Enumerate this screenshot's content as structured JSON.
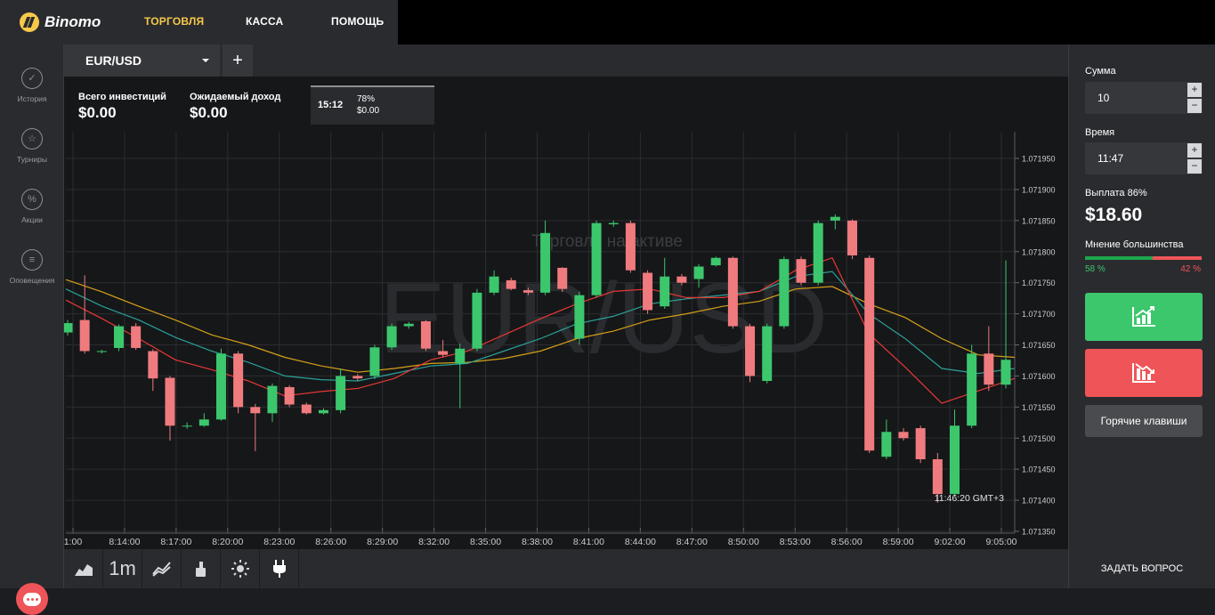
{
  "header": {
    "brand": "Binomo",
    "nav": [
      "ТОРГОВЛЯ",
      "КАССА",
      "ПОМОЩЬ"
    ]
  },
  "sidebar": {
    "items": [
      {
        "label": "История",
        "icon": "check-circle-icon"
      },
      {
        "label": "Турниры",
        "icon": "trophy-star-icon"
      },
      {
        "label": "Акции",
        "icon": "percent-circle-icon"
      },
      {
        "label": "Оповещения",
        "icon": "menu-lines-icon"
      }
    ]
  },
  "tab": {
    "symbol": "EUR/USD",
    "add_label": "+"
  },
  "stats": {
    "total_label": "Всего инвестиций",
    "total_value": "$0.00",
    "expected_label": "Ожидаемый доход",
    "expected_value": "$0.00"
  },
  "deal": {
    "time": "15:12",
    "percent": "78%",
    "amount": "$0.00"
  },
  "chart_data": {
    "type": "candlestick",
    "watermark": "EUR/USD",
    "overlay_text": "Торговля на активе",
    "time_label": "11:46:20 GMT+3",
    "y_ticks": [
      "1.071950",
      "1.071900",
      "1.071850",
      "1.071800",
      "1.071750",
      "1.071700",
      "1.071650",
      "1.071600",
      "1.071550",
      "1.071500",
      "1.071450",
      "1.071400",
      "1.071350"
    ],
    "ylim": [
      1.07135,
      1.07195
    ],
    "x_ticks": [
      "1:00",
      "8:14:00",
      "8:17:00",
      "8:20:00",
      "8:23:00",
      "8:26:00",
      "8:29:00",
      "8:32:00",
      "8:35:00",
      "8:38:00",
      "8:41:00",
      "8:44:00",
      "8:47:00",
      "8:50:00",
      "8:53:00",
      "8:56:00",
      "8:59:00",
      "9:02:00",
      "9:05:00"
    ],
    "up_color": "#3cc76d",
    "down_color": "#ef7b7e",
    "candles": [
      {
        "o": 1.07167,
        "c": 1.071685,
        "h": 1.07169,
        "l": 1.071665
      },
      {
        "o": 1.07169,
        "c": 1.07164,
        "h": 1.071762,
        "l": 1.071636
      },
      {
        "o": 1.07164,
        "c": 1.07164,
        "h": 1.071642,
        "l": 1.071636
      },
      {
        "o": 1.071645,
        "c": 1.07168,
        "h": 1.071683,
        "l": 1.07164
      },
      {
        "o": 1.07168,
        "c": 1.071645,
        "h": 1.071685,
        "l": 1.071642
      },
      {
        "o": 1.07164,
        "c": 1.071596,
        "h": 1.071643,
        "l": 1.071576
      },
      {
        "o": 1.071597,
        "c": 1.07152,
        "h": 1.0716,
        "l": 1.071496
      },
      {
        "o": 1.07152,
        "c": 1.07152,
        "h": 1.071525,
        "l": 1.071515
      },
      {
        "o": 1.07152,
        "c": 1.07153,
        "h": 1.07154,
        "l": 1.071518
      },
      {
        "o": 1.07153,
        "c": 1.071636,
        "h": 1.071644,
        "l": 1.071528
      },
      {
        "o": 1.071636,
        "c": 1.07155,
        "h": 1.07164,
        "l": 1.07154
      },
      {
        "o": 1.07155,
        "c": 1.07154,
        "h": 1.071555,
        "l": 1.071479
      },
      {
        "o": 1.07154,
        "c": 1.071584,
        "h": 1.071588,
        "l": 1.071526
      },
      {
        "o": 1.071582,
        "c": 1.071554,
        "h": 1.071585,
        "l": 1.07155
      },
      {
        "o": 1.071554,
        "c": 1.07154,
        "h": 1.071557,
        "l": 1.071538
      },
      {
        "o": 1.07154,
        "c": 1.071545,
        "h": 1.071548,
        "l": 1.071538
      },
      {
        "o": 1.071545,
        "c": 1.0716,
        "h": 1.071612,
        "l": 1.07154
      },
      {
        "o": 1.0716,
        "c": 1.071596,
        "h": 1.071603,
        "l": 1.071592
      },
      {
        "o": 1.0716,
        "c": 1.071646,
        "h": 1.07165,
        "l": 1.071595
      },
      {
        "o": 1.071646,
        "c": 1.07168,
        "h": 1.071684,
        "l": 1.071642
      },
      {
        "o": 1.07168,
        "c": 1.071684,
        "h": 1.071687,
        "l": 1.071676
      },
      {
        "o": 1.071688,
        "c": 1.071644,
        "h": 1.07169,
        "l": 1.07164
      },
      {
        "o": 1.07164,
        "c": 1.071634,
        "h": 1.071658,
        "l": 1.07163
      },
      {
        "o": 1.07162,
        "c": 1.071644,
        "h": 1.071652,
        "l": 1.071548
      },
      {
        "o": 1.071644,
        "c": 1.071734,
        "h": 1.07174,
        "l": 1.07164
      },
      {
        "o": 1.071734,
        "c": 1.07176,
        "h": 1.07177,
        "l": 1.07173
      },
      {
        "o": 1.071754,
        "c": 1.07174,
        "h": 1.071758,
        "l": 1.071738
      },
      {
        "o": 1.071738,
        "c": 1.071734,
        "h": 1.071742,
        "l": 1.07173
      },
      {
        "o": 1.071734,
        "c": 1.07183,
        "h": 1.07185,
        "l": 1.07173
      },
      {
        "o": 1.071774,
        "c": 1.07174,
        "h": 1.071775,
        "l": 1.071735
      },
      {
        "o": 1.07166,
        "c": 1.07173,
        "h": 1.071736,
        "l": 1.07165
      },
      {
        "o": 1.07173,
        "c": 1.071846,
        "h": 1.07185,
        "l": 1.071726
      },
      {
        "o": 1.071844,
        "c": 1.071846,
        "h": 1.07185,
        "l": 1.07184
      },
      {
        "o": 1.071846,
        "c": 1.07177,
        "h": 1.07185,
        "l": 1.071766
      },
      {
        "o": 1.071766,
        "c": 1.071706,
        "h": 1.07177,
        "l": 1.0717
      },
      {
        "o": 1.071712,
        "c": 1.07176,
        "h": 1.07179,
        "l": 1.071708
      },
      {
        "o": 1.07176,
        "c": 1.07175,
        "h": 1.071764,
        "l": 1.071746
      },
      {
        "o": 1.071756,
        "c": 1.071776,
        "h": 1.07178,
        "l": 1.071742
      },
      {
        "o": 1.071778,
        "c": 1.07179,
        "h": 1.071792,
        "l": 1.071776
      },
      {
        "o": 1.07179,
        "c": 1.07168,
        "h": 1.071792,
        "l": 1.071676
      },
      {
        "o": 1.07168,
        "c": 1.0716,
        "h": 1.071684,
        "l": 1.07159
      },
      {
        "o": 1.071592,
        "c": 1.07168,
        "h": 1.071684,
        "l": 1.071588
      },
      {
        "o": 1.07168,
        "c": 1.071788,
        "h": 1.071792,
        "l": 1.071676
      },
      {
        "o": 1.071788,
        "c": 1.07175,
        "h": 1.071792,
        "l": 1.071746
      },
      {
        "o": 1.07175,
        "c": 1.071846,
        "h": 1.07185,
        "l": 1.071746
      },
      {
        "o": 1.07185,
        "c": 1.071856,
        "h": 1.07186,
        "l": 1.071836
      },
      {
        "o": 1.07185,
        "c": 1.071794,
        "h": 1.071852,
        "l": 1.071788
      },
      {
        "o": 1.07179,
        "c": 1.07148,
        "h": 1.071794,
        "l": 1.071476
      },
      {
        "o": 1.07147,
        "c": 1.07151,
        "h": 1.07153,
        "l": 1.071466
      },
      {
        "o": 1.07151,
        "c": 1.0715,
        "h": 1.071516,
        "l": 1.071496
      },
      {
        "o": 1.071516,
        "c": 1.071466,
        "h": 1.07152,
        "l": 1.07146
      },
      {
        "o": 1.071466,
        "c": 1.07141,
        "h": 1.071476,
        "l": 1.071396
      },
      {
        "o": 1.07141,
        "c": 1.07152,
        "h": 1.071546,
        "l": 1.071406
      },
      {
        "o": 1.07152,
        "c": 1.071636,
        "h": 1.07165,
        "l": 1.071516
      },
      {
        "o": 1.071636,
        "c": 1.071586,
        "h": 1.07168,
        "l": 1.071576
      },
      {
        "o": 1.071586,
        "c": 1.071626,
        "h": 1.071786,
        "l": 1.07158
      }
    ],
    "ma_lines": [
      {
        "color": "#d4a017",
        "values": [
          1.071755,
          1.071735,
          1.071712,
          1.07169,
          1.071666,
          1.07165,
          1.07163,
          1.071616,
          1.071606,
          1.071612,
          1.07162,
          1.071622,
          1.071628,
          1.07164,
          1.07166,
          1.071672,
          1.07169,
          1.0717,
          1.071712,
          1.07172,
          1.07174,
          1.071744,
          1.071716,
          1.071694,
          1.07166,
          1.071634,
          1.07163
        ]
      },
      {
        "color": "#2aa198",
        "values": [
          1.07174,
          1.071712,
          1.07169,
          1.071662,
          1.07164,
          1.071622,
          1.0716,
          1.071594,
          1.071592,
          1.071604,
          1.071616,
          1.07162,
          1.07164,
          1.07166,
          1.071684,
          1.071696,
          1.071716,
          1.071724,
          1.07173,
          1.071736,
          1.07176,
          1.071768,
          1.0717,
          1.07166,
          1.071612,
          1.071604,
          1.071612
        ]
      },
      {
        "color": "#e53935",
        "values": [
          1.071722,
          1.071692,
          1.07166,
          1.071626,
          1.07161,
          1.071592,
          1.071568,
          1.071575,
          1.07158,
          1.071596,
          1.071626,
          1.07164,
          1.071666,
          1.071692,
          1.071716,
          1.071736,
          1.07174,
          1.071726,
          1.071726,
          1.071736,
          1.07177,
          1.07179,
          1.071668,
          1.071614,
          1.071556,
          1.071576,
          1.071596
        ]
      }
    ]
  },
  "right_panel": {
    "amount_label": "Сумма",
    "amount_value": "10",
    "time_label": "Время",
    "time_value": "11:47",
    "stepper_plus": "+",
    "stepper_minus": "−",
    "payout_label": "Выплата 86%",
    "payout_value": "$18.60",
    "majority_label": "Мнение большинства",
    "majority_up_pct": "58 %",
    "majority_down_pct": "42 %",
    "majority_up_fraction": 0.58,
    "hotkeys_label": "Горячие клавиши",
    "ask_label": "ЗАДАТЬ ВОПРОС"
  },
  "toolbar": {
    "timeframe": "1m"
  }
}
